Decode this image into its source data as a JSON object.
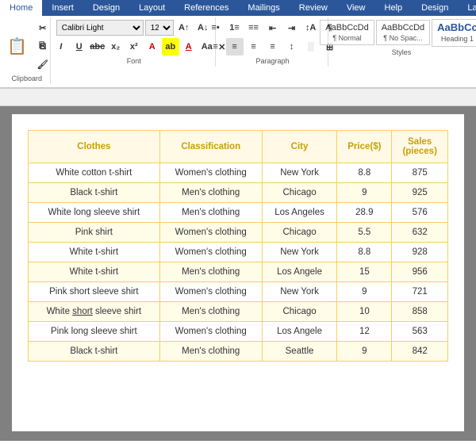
{
  "ribbon": {
    "tabs": [
      "Home",
      "Insert",
      "Design",
      "Layout",
      "References",
      "Mailings",
      "Review",
      "View",
      "Help",
      "Design",
      "Layout"
    ],
    "active_tab": "Home",
    "font": {
      "family": "Calibri Light",
      "size": "12",
      "group_label": "Font"
    },
    "paragraph": {
      "group_label": "Paragraph"
    },
    "styles": {
      "group_label": "Styles",
      "items": [
        {
          "label": "¶ Normal",
          "sub": "",
          "style": "normal"
        },
        {
          "label": "¶ No Spac...",
          "sub": "",
          "style": "nospace"
        },
        {
          "label": "AaBbCc",
          "sub": "Heading 1",
          "style": "h1"
        }
      ]
    }
  },
  "table": {
    "headers": [
      "Clothes",
      "Classification",
      "City",
      "Price($)",
      "Sales\n(pieces)"
    ],
    "rows": [
      {
        "clothes": "White cotton t-shirt",
        "classification": "Women's clothing",
        "city": "New York",
        "price": "8.8",
        "sales": "875",
        "yellow": false
      },
      {
        "clothes": "Black t-shirt",
        "classification": "Men's clothing",
        "city": "Chicago",
        "price": "9",
        "sales": "925",
        "yellow": true
      },
      {
        "clothes": "White long sleeve shirt",
        "classification": "Men's clothing",
        "city": "Los Angeles",
        "price": "28.9",
        "sales": "576",
        "yellow": false
      },
      {
        "clothes": "Pink shirt",
        "classification": "Women's clothing",
        "city": "Chicago",
        "price": "5.5",
        "sales": "632",
        "yellow": true
      },
      {
        "clothes": "White t-shirt",
        "classification": "Women's clothing",
        "city": "New York",
        "price": "8.8",
        "sales": "928",
        "yellow": false
      },
      {
        "clothes": "White t-shirt",
        "classification": "Men's clothing",
        "city": "Los Angele",
        "price": "15",
        "sales": "956",
        "yellow": true
      },
      {
        "clothes": "Pink short sleeve shirt",
        "classification": "Women's clothing",
        "city": "New York",
        "price": "9",
        "sales": "721",
        "yellow": false
      },
      {
        "clothes": "White short sleeve shirt",
        "classification": "Men's clothing",
        "city": "Chicago",
        "price": "10",
        "sales": "858",
        "yellow": true,
        "underline": "short"
      },
      {
        "clothes": "Pink long sleeve shirt",
        "classification": "Women's clothing",
        "city": "Los Angele",
        "price": "12",
        "sales": "563",
        "yellow": false
      },
      {
        "clothes": "Black t-shirt",
        "classification": "Men's clothing",
        "city": "Seattle",
        "price": "9",
        "sales": "842",
        "yellow": true
      }
    ]
  },
  "colors": {
    "ribbon_blue": "#2b579a",
    "header_gold": "#c8a000",
    "table_border": "#f5d060",
    "table_header_bg": "#fff9e6"
  }
}
